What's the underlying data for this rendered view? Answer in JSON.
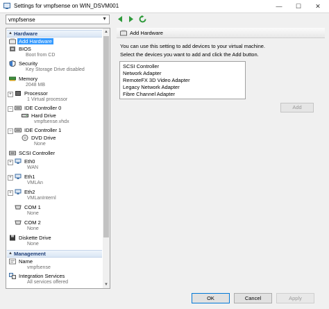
{
  "window": {
    "title": "Settings for vmpfsense on WIN_DSVM001",
    "minimize_glyph": "—",
    "maximize_glyph": "☐",
    "close_glyph": "✕"
  },
  "vm_selector": {
    "value": "vmpfsense"
  },
  "sidebar": {
    "sections": [
      {
        "label": "Hardware",
        "expander": "▲"
      },
      {
        "label": "Management",
        "expander": "▲"
      }
    ],
    "items": [
      {
        "title": "Add Hardware",
        "sub": ""
      },
      {
        "title": "BIOS",
        "sub": "Boot from CD"
      },
      {
        "title": "Security",
        "sub": "Key Storage Drive disabled"
      },
      {
        "title": "Memory",
        "sub": "2048 MB"
      },
      {
        "title": "Processor",
        "sub": "1 Virtual processor",
        "expander": "+"
      },
      {
        "title": "IDE Controller 0",
        "sub": "",
        "expander": "−"
      },
      {
        "title": "Hard Drive",
        "sub": "vmpfsense.vhdx"
      },
      {
        "title": "IDE Controller 1",
        "sub": "",
        "expander": "−"
      },
      {
        "title": "DVD Drive",
        "sub": "None"
      },
      {
        "title": "SCSI Controller",
        "sub": ""
      },
      {
        "title": "Eth0",
        "sub": "WAN",
        "expander": "+"
      },
      {
        "title": "Eth1",
        "sub": "VMLAn",
        "expander": "+"
      },
      {
        "title": "Eth2",
        "sub": "VMLanInternl",
        "expander": "+"
      },
      {
        "title": "COM 1",
        "sub": "None"
      },
      {
        "title": "COM 2",
        "sub": "None"
      },
      {
        "title": "Diskette Drive",
        "sub": "None"
      },
      {
        "title": "Name",
        "sub": "vmpfsense"
      },
      {
        "title": "Integration Services",
        "sub": "All services offered"
      }
    ],
    "scroll_up_glyph": "▲",
    "scroll_down_glyph": "▼"
  },
  "panel": {
    "header": "Add Hardware",
    "description1": "You can use this setting to add devices to your virtual machine.",
    "description2": "Select the devices you want to add and click the Add button.",
    "devices": [
      "SCSI Controller",
      "Network Adapter",
      "RemoteFX 3D Video Adapter",
      "Legacy Network Adapter",
      "Fibre Channel Adapter"
    ],
    "add_label": "Add"
  },
  "footer": {
    "ok_label": "OK",
    "cancel_label": "Cancel",
    "apply_label": "Apply"
  },
  "colors": {
    "accent": "#3399ff",
    "section_text": "#1f3f78",
    "nav_green": "#2e9a3a"
  }
}
